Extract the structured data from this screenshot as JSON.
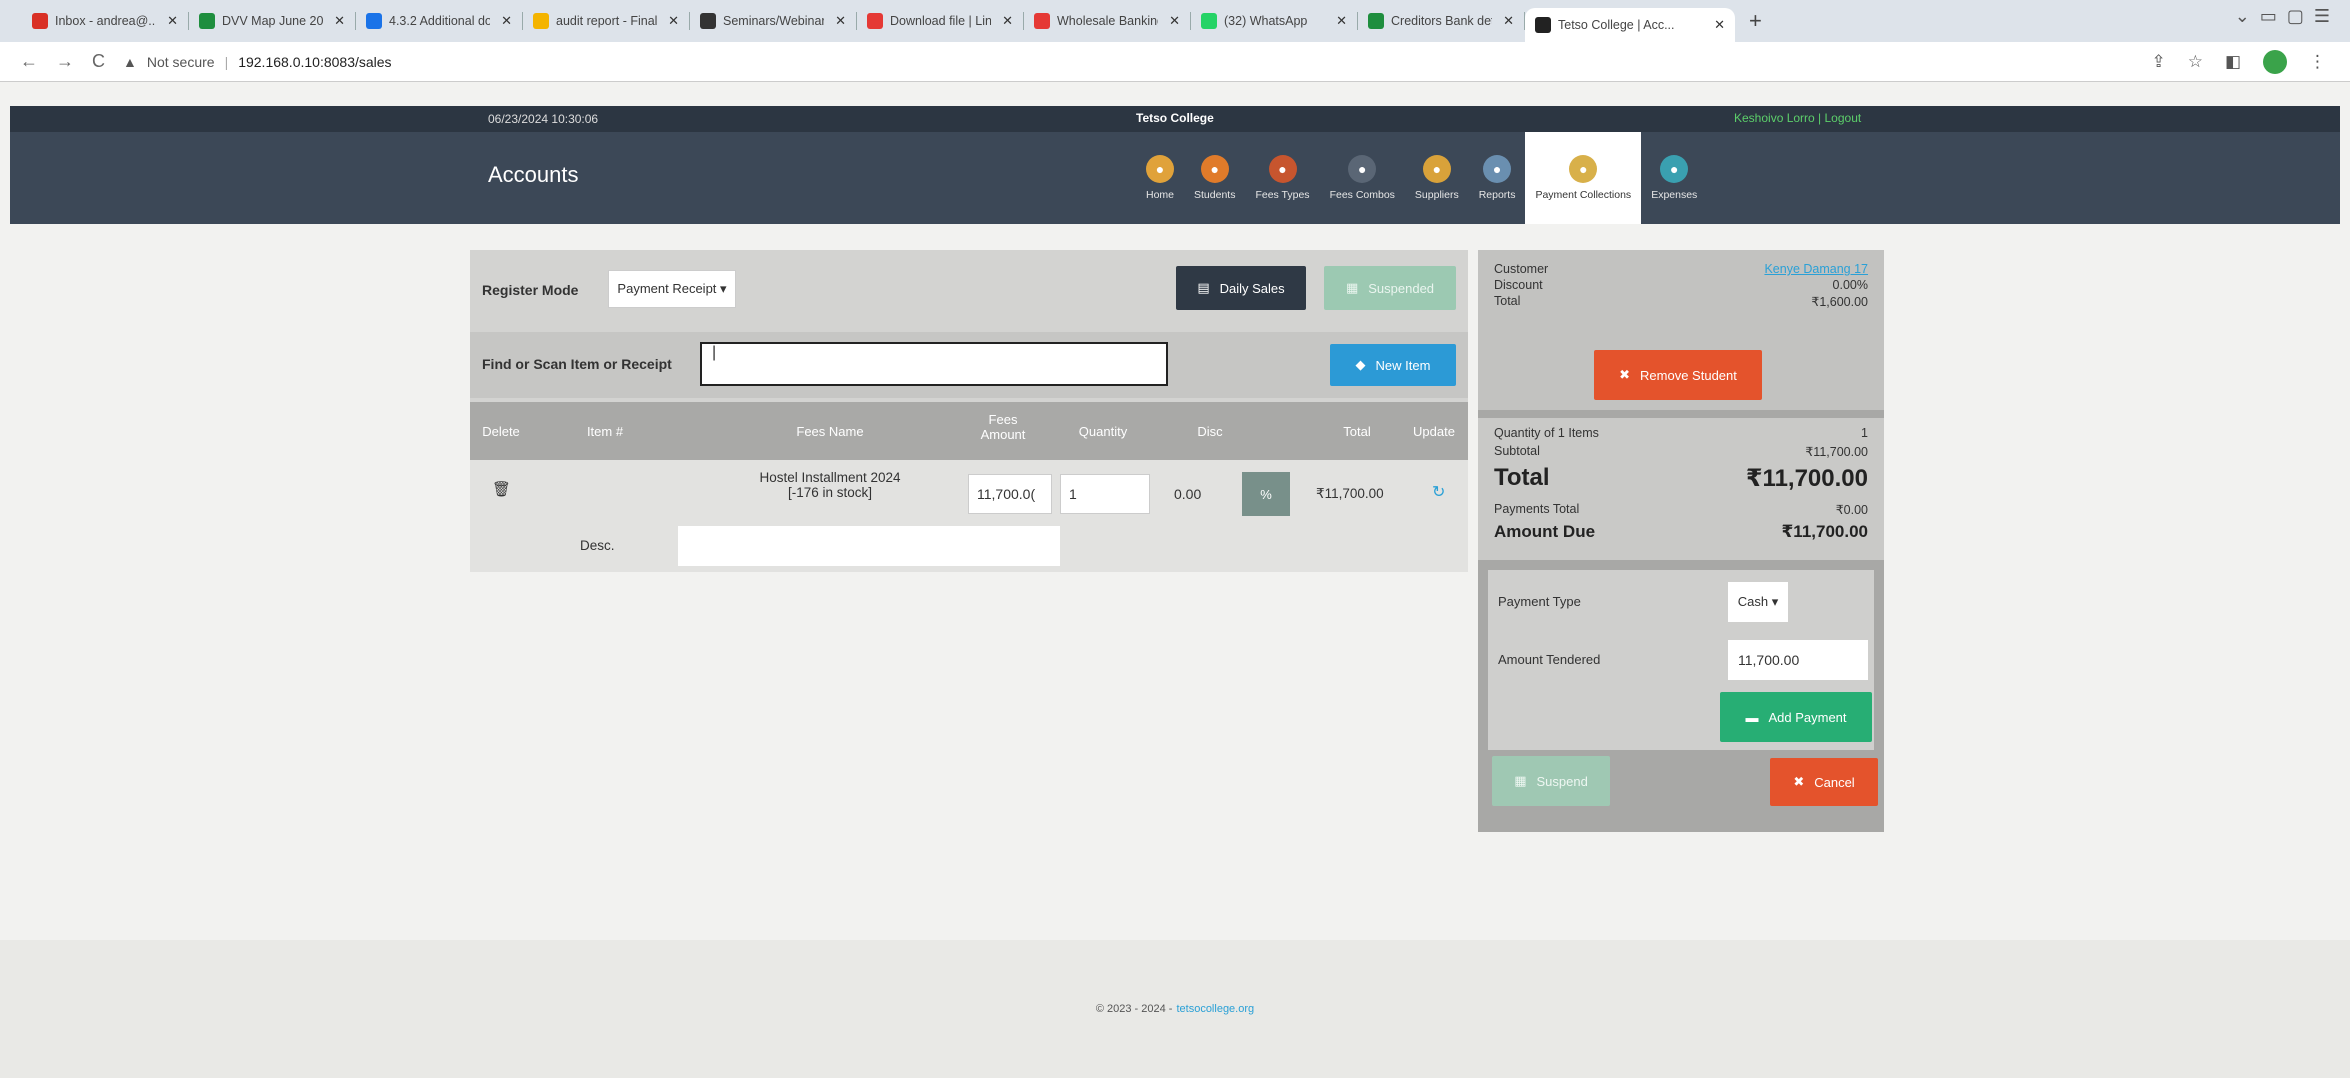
{
  "browser": {
    "tabs": [
      {
        "title": "Inbox - andrea@...",
        "color": "#d93025",
        "active": false
      },
      {
        "title": "DVV Map June 202...",
        "color": "#1e8e3e",
        "active": false
      },
      {
        "title": "4.3.2 Additional do...",
        "color": "#1a73e8",
        "active": false
      },
      {
        "title": "audit report - Final",
        "color": "#f4b400",
        "active": false
      },
      {
        "title": "Seminars/Webinars",
        "color": "#333333",
        "active": false
      },
      {
        "title": "Download file | Lin...",
        "color": "#e53935",
        "active": false
      },
      {
        "title": "Wholesale Banking",
        "color": "#e53935",
        "active": false
      },
      {
        "title": "(32) WhatsApp",
        "color": "#25d366",
        "active": false
      },
      {
        "title": "Creditors Bank deta...",
        "color": "#1e8e3e",
        "active": false
      },
      {
        "title": "Tetso College | Acc...",
        "color": "#222222",
        "active": true
      }
    ],
    "address": {
      "security": "Not secure",
      "url": "192.168.0.10:8083/sales"
    }
  },
  "header": {
    "datetime": "06/23/2024 10:30:06",
    "college": "Tetso College",
    "user_links": "Keshoivo Lorro | Logout",
    "brand": "Accounts",
    "menu": [
      {
        "label": "Home",
        "color": "#e0a23a",
        "icon": "home-icon",
        "active": false
      },
      {
        "label": "Students",
        "color": "#e07b2a",
        "icon": "students-icon",
        "active": false
      },
      {
        "label": "Fees Types",
        "color": "#c7552e",
        "icon": "fees-types-icon",
        "active": false
      },
      {
        "label": "Fees Combos",
        "color": "#5a6675",
        "icon": "fees-combos-icon",
        "active": false
      },
      {
        "label": "Suppliers",
        "color": "#d9a23a",
        "icon": "suppliers-icon",
        "active": false
      },
      {
        "label": "Reports",
        "color": "#6a8fb0",
        "icon": "reports-icon",
        "active": false
      },
      {
        "label": "Payment Collections",
        "color": "#d8b04a",
        "icon": "payment-collections-icon",
        "active": true
      },
      {
        "label": "Expenses",
        "color": "#3aa0b0",
        "icon": "expenses-icon",
        "active": false
      }
    ]
  },
  "register": {
    "mode_label": "Register Mode",
    "mode_value": "Payment Receipt ▾",
    "daily_sales": "Daily Sales",
    "suspended": "Suspended",
    "find_label": "Find or Scan Item or Receipt",
    "find_value": "|",
    "new_item": "New Item",
    "columns": [
      "Delete",
      "Item #",
      "Fees Name",
      "Fees Amount",
      "Quantity",
      "Disc",
      "Total",
      "Update"
    ],
    "row": {
      "fees_name": "Hostel Installment 2024",
      "stock": "[-176 in stock]",
      "amount": "11,700.0(",
      "quantity": "1",
      "disc": "0.00",
      "pct": "%",
      "total": "₹11,700.00",
      "desc_label": "Desc."
    }
  },
  "sidebar": {
    "customer_label": "Customer",
    "customer_value": "Kenye Damang 17",
    "discount_label": "Discount",
    "discount_value": "0.00%",
    "total_label": "Total",
    "total_value": "₹1,600.00",
    "remove_student": "Remove Student",
    "qty_label": "Quantity of 1 Items",
    "qty_value": "1",
    "subtotal_label": "Subtotal",
    "subtotal_value": "₹11,700.00",
    "big_total_label": "Total",
    "big_total_value": "₹11,700.00",
    "payments_total_label": "Payments Total",
    "payments_total_value": "₹0.00",
    "amount_due_label": "Amount Due",
    "amount_due_value": "₹11,700.00",
    "payment_type_label": "Payment Type",
    "payment_type_value": "Cash ▾",
    "tendered_label": "Amount Tendered",
    "tendered_value": "11,700.00",
    "add_payment": "Add Payment",
    "suspend": "Suspend",
    "cancel": "Cancel"
  },
  "footer": {
    "copyright": "© 2023 - 2024 -",
    "link": "tetsocollege.org"
  }
}
